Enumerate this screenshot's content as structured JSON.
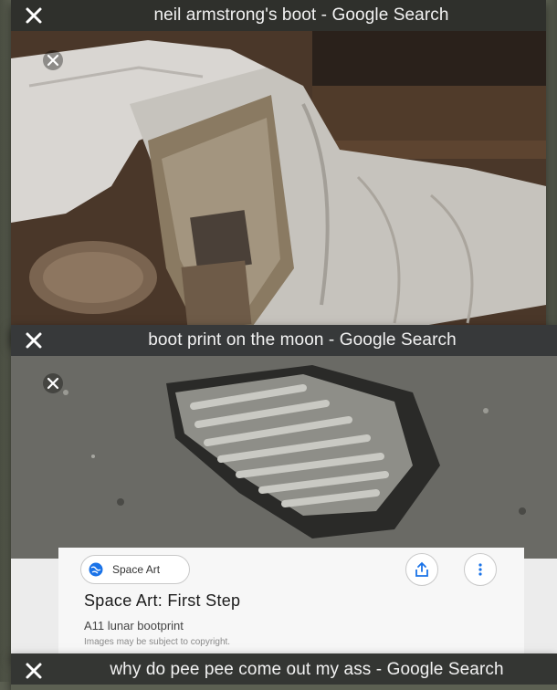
{
  "tabs": [
    {
      "title": "neil armstrong's boot - Google Search",
      "close_icon": "x-close-icon"
    },
    {
      "title": "boot print on the moon - Google Search",
      "close_icon": "x-close-icon",
      "result": {
        "source_label": "Space Art",
        "source_icon": "globe-icon",
        "title": "Space Art: First Step",
        "description": "A11 lunar bootprint",
        "copyright_note": "Images may be subject to copyright.",
        "share_icon": "share-icon",
        "more_icon": "more-vert-icon"
      }
    },
    {
      "title": "why do pee pee come out my ass - Google Search",
      "close_icon": "x-close-icon"
    }
  ],
  "colors": {
    "header_bg": "#37393a",
    "header_text": "#f2f2f2",
    "card_bg": "#f7f7f7",
    "accent_blue": "#1a73e8"
  }
}
